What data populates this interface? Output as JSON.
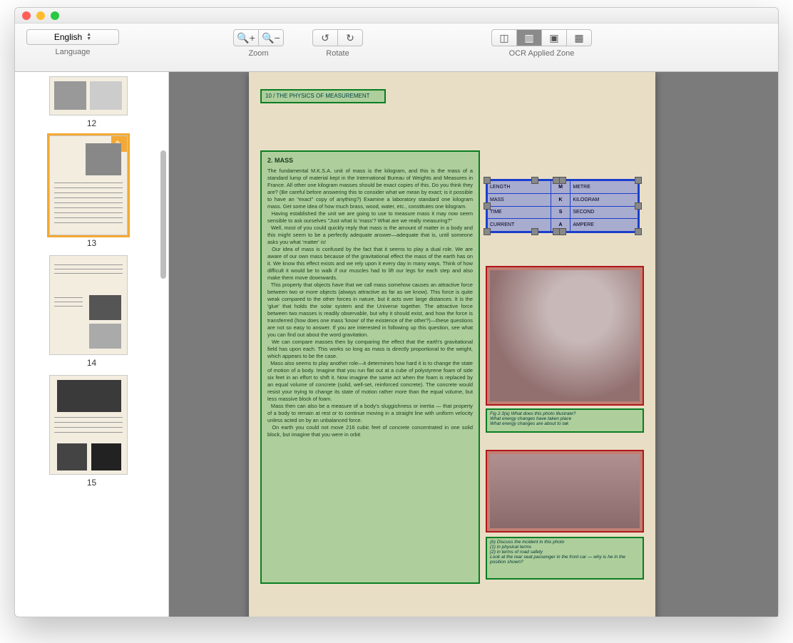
{
  "toolbar": {
    "language": {
      "label": "Language",
      "selected": "English"
    },
    "zoom": {
      "label": "Zoom"
    },
    "rotate": {
      "label": "Rotate"
    },
    "ocr_zone": {
      "label": "OCR Applied Zone"
    }
  },
  "thumbnails": [
    {
      "num": "12",
      "selected": false
    },
    {
      "num": "13",
      "selected": true
    },
    {
      "num": "14",
      "selected": false
    },
    {
      "num": "15",
      "selected": false
    }
  ],
  "page": {
    "header": "10 / THE PHYSICS OF MEASUREMENT",
    "section_heading": "2. MASS",
    "body": "The fundamental M.K.S.A. unit of mass is the kilogram, and this is the mass of a standard lump of material kept in the International Bureau of Weights and Measures in France. All other one kilogram masses should be exact copies of this. Do you think they are? (Be careful before answering this to consider what we mean by exact; is it possible to have an \"exact\" copy of anything?) Examine a laboratory standard one kilogram mass. Get some idea of how much brass, wood, water, etc., constitutes one kilogram.\n  Having established the unit we are going to use to measure mass it may now seem sensible to ask ourselves \"Just what is 'mass'? What are we really measuring?\"\n  Well, most of you could quickly reply that mass is the amount of matter in a body and this might seem to be a perfectly adequate answer—adequate that is, until someone asks you what 'matter' is!\n  Our idea of mass is confused by the fact that it seems to play a dual role. We are aware of our own mass because of the gravitational effect the mass of the earth has on it. We know this effect exists and we rely upon it every day in many ways. Think of how difficult it would be to walk if our muscles had to lift our legs for each step and also make them move downwards.\n  This property that objects have that we call mass somehow causes an attractive force between two or more objects (always attractive as far as we know). This force is quite weak compared to the other forces in nature, but it acts over large distances. It is the 'glue' that holds the solar system and the Universe together. The attractive force between two masses is readily observable, but why it should exist, and how the force is transferred (how does one mass 'know' of the existence of the other?)—these questions are not so easy to answer. If you are interested in following up this question, see what you can find out about the word gravitation.\n  We can compare masses then by comparing the effect that the earth's gravitational field has upon each. This works so long as mass is directly proportional to the weight, which appears to be the case.\n  Mass also seems to play another role—it determines how hard it is to change the state of motion of a body. Imagine that you run flat out at a cube of polystyrene foam of side six feet in an effort to shift it. Now imagine the same act when the foam is replaced by an equal volume of concrete (solid, well-set, reinforced concrete). The concrete would resist your trying to change its state of motion rather more than the equal volume, but less massive block of foam.\n  Mass then can also be a measure of a body's sluggishness or inertia — that property of a body to remain at rest or to continue moving in a straight line with uniform velocity unless acted on by an unbalanced force.\n  On earth you could not move 216 cubic feet of concrete concentrated in one solid block, but imagine that you were in orbit",
    "table": {
      "rows": [
        {
          "qty": "LENGTH",
          "sym": "M",
          "unit": "METRE"
        },
        {
          "qty": "MASS",
          "sym": "K",
          "unit": "KILOGRAM"
        },
        {
          "qty": "TIME",
          "sym": "S",
          "unit": "SECOND"
        },
        {
          "qty": "CURRENT",
          "sym": "A",
          "unit": "AMPERE"
        }
      ]
    },
    "caption1": "Fig 2.3(a) What does this photo illustrate?\nWhat energy changes have taken place\nWhat energy changes are about to tak",
    "caption2": "(b) Discuss the incident in this photo\n(1) in physical terms\n(2) in terms of road safety\nLook at the rear seat passenger in the front car — why is he in the position shown?"
  }
}
